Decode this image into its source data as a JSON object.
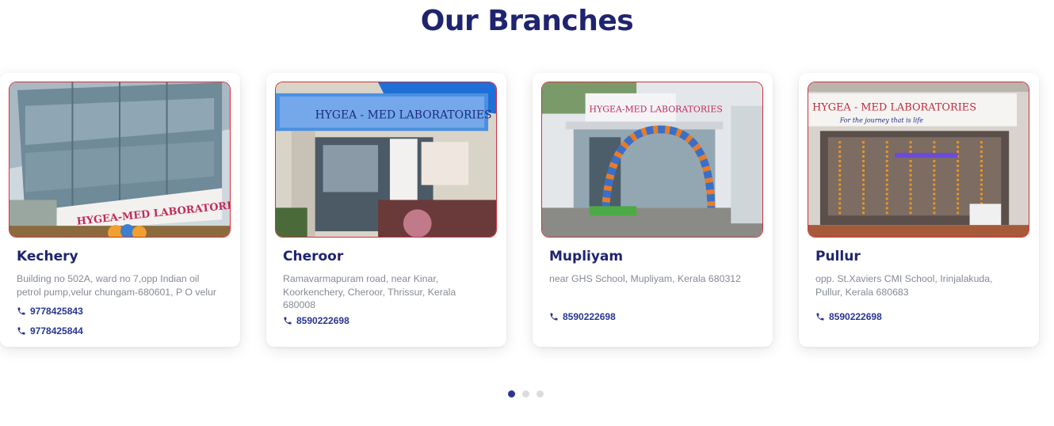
{
  "section": {
    "title": "Our Branches"
  },
  "branches": [
    {
      "name": "Kechery",
      "address": "Building no 502A, ward no 7,opp Indian oil petrol pump,velur chungam-680601, P O velur",
      "phones": [
        "9778425843",
        "9778425844"
      ],
      "sign_text": "HYGEA-MED LABORATORIES"
    },
    {
      "name": "Cheroor",
      "address": "Ramavarmapuram road, near Kinar, Koorkenchery, Cheroor, Thrissur, Kerala 680008",
      "phones": [
        "8590222698"
      ],
      "sign_text": "HYGEA - MED LABORATORIES"
    },
    {
      "name": "Mupliyam",
      "address": "near GHS School, Mupliyam, Kerala 680312",
      "phones": [
        "8590222698"
      ],
      "sign_text": "HYGEA-MED LABORATORIES"
    },
    {
      "name": "Pullur",
      "address": "opp. St.Xaviers CMI School, Irinjalakuda, Pullur, Kerala 680683",
      "phones": [
        "8590222698"
      ],
      "sign_text": "HYGEA - MED LABORATORIES",
      "sign_tagline": "For the journey that is life"
    }
  ],
  "carousel": {
    "page_count": 3,
    "active_index": 0
  },
  "colors": {
    "title": "#1f2470",
    "phone": "#283593",
    "dot_active": "#2c3596",
    "dot_inactive": "#dcdcdc"
  },
  "icons": {
    "phone": "phone-icon"
  }
}
